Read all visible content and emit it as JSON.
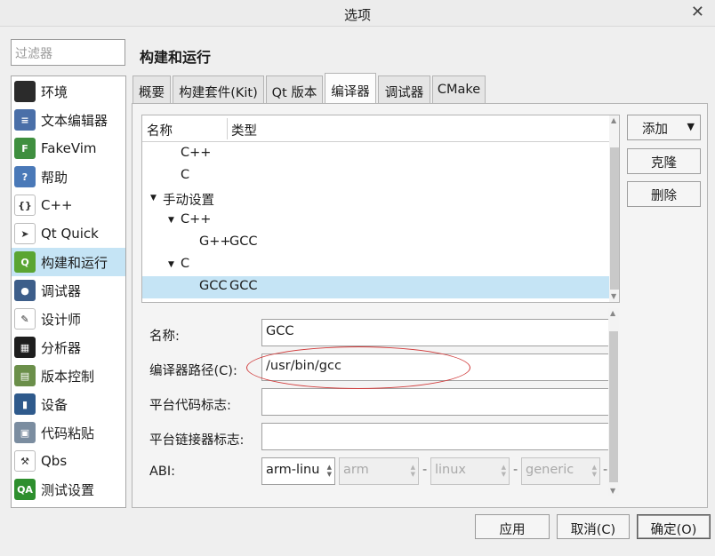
{
  "window": {
    "title": "选项",
    "close": "✕"
  },
  "filter": {
    "placeholder": "过滤器"
  },
  "sidebar": {
    "items": [
      {
        "label": "环境",
        "icon": "monitor-icon",
        "color": "#2b2b2b",
        "glyph": ""
      },
      {
        "label": "文本编辑器",
        "icon": "document-icon",
        "color": "#4a6fa8",
        "glyph": "≡"
      },
      {
        "label": "FakeVim",
        "icon": "fakevim-icon",
        "color": "#3f8f3f",
        "glyph": "F"
      },
      {
        "label": "帮助",
        "icon": "help-icon",
        "color": "#4a79b8",
        "glyph": "?"
      },
      {
        "label": "C++",
        "icon": "braces-icon",
        "color": "#ffffff",
        "glyph": "{}"
      },
      {
        "label": "Qt Quick",
        "icon": "paper-plane-icon",
        "color": "#ffffff",
        "glyph": "➤"
      },
      {
        "label": "构建和运行",
        "icon": "qt-build-icon",
        "color": "#5aa532",
        "glyph": "Q"
      },
      {
        "label": "调试器",
        "icon": "bug-icon",
        "color": "#3d5e8a",
        "glyph": "●"
      },
      {
        "label": "设计师",
        "icon": "pencil-icon",
        "color": "#ffffff",
        "glyph": "✎"
      },
      {
        "label": "分析器",
        "icon": "analyzer-icon",
        "color": "#1e1e1e",
        "glyph": "▦"
      },
      {
        "label": "版本控制",
        "icon": "version-control-icon",
        "color": "#6b8f4a",
        "glyph": "▤"
      },
      {
        "label": "设备",
        "icon": "device-icon",
        "color": "#2f5a8c",
        "glyph": "▮"
      },
      {
        "label": "代码粘贴",
        "icon": "paste-icon",
        "color": "#7b8da0",
        "glyph": "▣"
      },
      {
        "label": "Qbs",
        "icon": "hammer-icon",
        "color": "#ffffff",
        "glyph": "⚒"
      },
      {
        "label": "测试设置",
        "icon": "qa-icon",
        "color": "#2e8f2e",
        "glyph": "QA"
      }
    ],
    "selected_index": 6
  },
  "page": {
    "title": "构建和运行"
  },
  "tabs": [
    {
      "label": "概要"
    },
    {
      "label": "构建套件(Kit)"
    },
    {
      "label": "Qt 版本"
    },
    {
      "label": "编译器"
    },
    {
      "label": "调试器"
    },
    {
      "label": "CMake"
    }
  ],
  "active_tab": 3,
  "tree": {
    "columns": [
      "名称",
      "类型"
    ],
    "rows": [
      {
        "name": "C++",
        "type": ""
      },
      {
        "name": "C",
        "type": ""
      },
      {
        "name": "手动设置",
        "type": "",
        "expander": "▼"
      },
      {
        "name": "C++",
        "type": "",
        "expander": "▼"
      },
      {
        "name": "G++",
        "type": "GCC"
      },
      {
        "name": "C",
        "type": "",
        "expander": "▼"
      },
      {
        "name": "GCC",
        "type": "GCC",
        "selected": true
      }
    ]
  },
  "buttons": {
    "add": "添加",
    "add_arrow": "▼",
    "clone": "克隆",
    "remove": "删除"
  },
  "form": {
    "name_label": "名称:",
    "name_value": "GCC",
    "path_label": "编译器路径(C):",
    "path_value": "/usr/bin/gcc",
    "platform_codegen_label": "平台代码标志:",
    "platform_codegen_value": "",
    "platform_linker_label": "平台链接器标志:",
    "platform_linker_value": "",
    "abi_label": "ABI:",
    "abi": {
      "arch": "arm-linu",
      "sub_arch": "arm",
      "os": "linux",
      "flavor": "generic",
      "sep": "-"
    }
  },
  "dialog_buttons": {
    "apply": "应用",
    "cancel": "取消(C)",
    "ok": "确定(O)"
  },
  "colors": {
    "selection": "#c5e4f5",
    "annotation": "#d03a3a"
  }
}
